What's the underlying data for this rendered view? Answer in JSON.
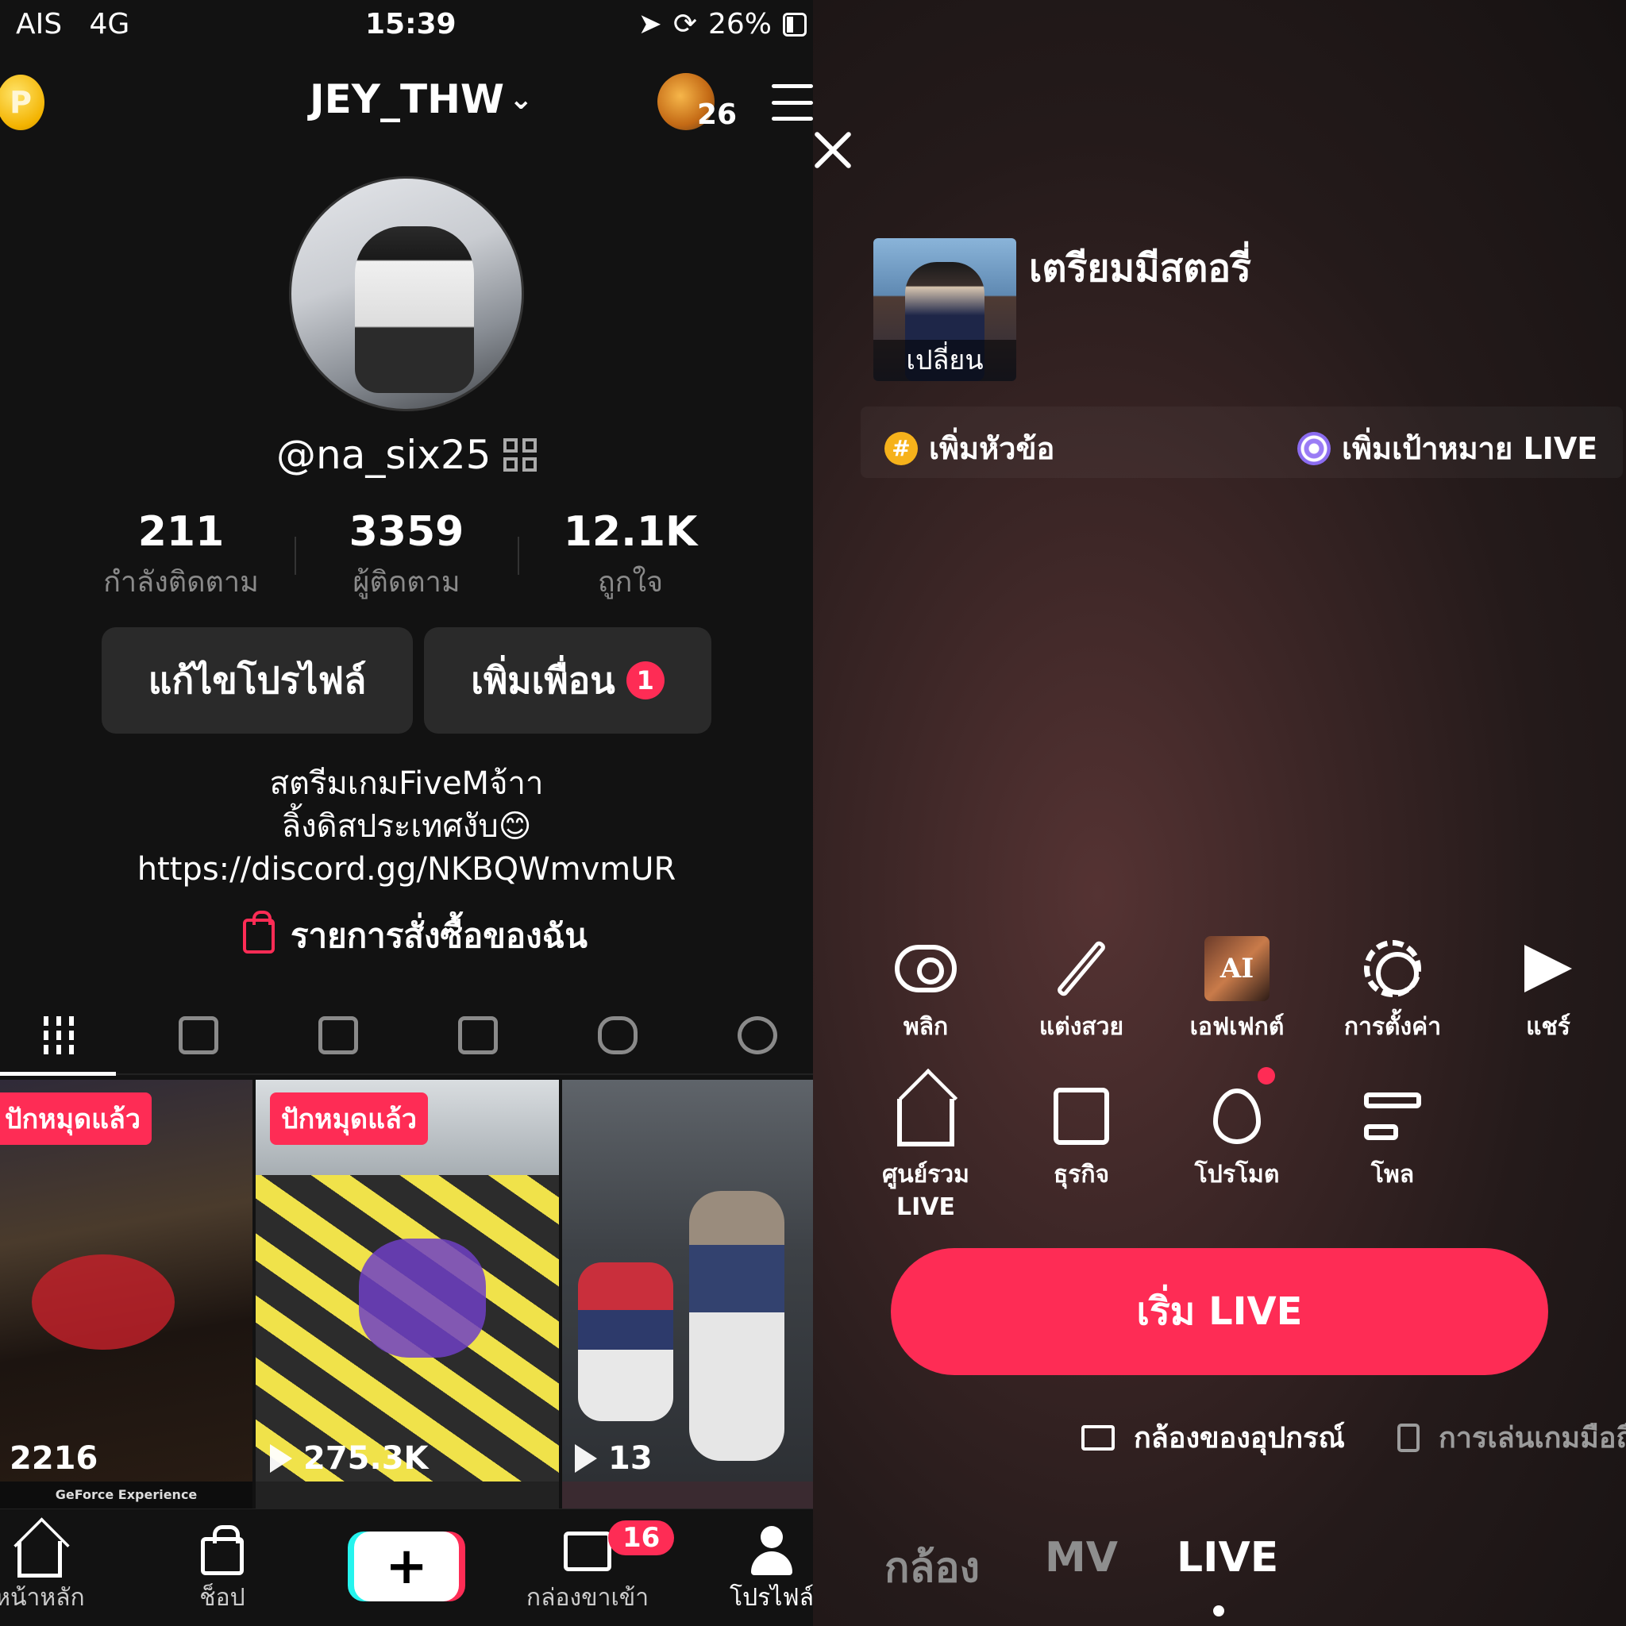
{
  "status_bar": {
    "carrier": "AIS",
    "network": "4G",
    "time": "15:39",
    "battery": "26%"
  },
  "profile": {
    "username": "JEY_THW",
    "avatar_badge_count": "26",
    "handle": "@na_six25",
    "stats": [
      {
        "value": "211",
        "label": "กำลังติดตาม"
      },
      {
        "value": "3359",
        "label": "ผู้ติดตาม"
      },
      {
        "value": "12.1K",
        "label": "ถูกใจ"
      }
    ],
    "edit_button": "แก้ไขโปรไฟล์",
    "add_friends_button": "เพิ่มเพื่อน",
    "add_friends_badge": "1",
    "bio_lines": [
      "สตรีมเกมFiveMจ้าา",
      "ลิ้งดิสประเทศงับ😊",
      "https://discord.gg/NKBQWmvmUR"
    ],
    "orders_link": "รายการสั่งซื้อของฉัน"
  },
  "videos": [
    {
      "tag": "ปักหมุดแล้ว",
      "views": "2216",
      "caption": "GeForce Experience"
    },
    {
      "tag": "ปักหมุดแล้ว",
      "views": "275.3K"
    },
    {
      "views": "13"
    }
  ],
  "bottom_nav": {
    "home": "หน้าหลัก",
    "shop": "ช็อป",
    "inbox": "กล่องขาเข้า",
    "inbox_badge": "16",
    "profile": "โปรไฟล์"
  },
  "live_setup": {
    "cover_change": "เปลี่ยน",
    "title": "เตรียมมีสตอรี่",
    "add_topic": "เพิ่มหัวข้อ",
    "add_goal": "เพิ่มเป้าหมาย LIVE",
    "tools": [
      "พลิก",
      "แต่งสวย",
      "เอฟเฟกต์",
      "การตั้งค่า",
      "แชร์",
      "ศูนย์รวม LIVE",
      "ธุรกิจ",
      "โปรโมต",
      "โพล"
    ],
    "effect_thumb_text": "AI",
    "start_button": "เริ่ม LIVE",
    "source_camera": "กล้องของอุปกรณ์",
    "source_game": "การเล่นเกมมือถือ",
    "modes": [
      "กล้อง",
      "MV",
      "LIVE"
    ]
  }
}
